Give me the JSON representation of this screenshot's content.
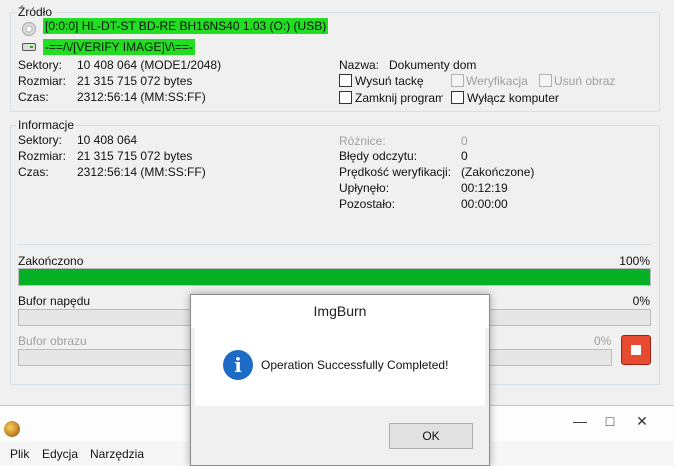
{
  "source": {
    "title": "Źródło",
    "drive": "[0:0:0] HL-DT-ST BD-RE  BH16NS40 1.03 (O:) (USB)",
    "image": "-==/\\/[VERIFY IMAGE]\\/\\==-",
    "sectors_label": "Sektory:",
    "sectors_value": "10 408 064 (MODE1/2048)",
    "size_label": "Rozmiar:",
    "size_value": "21 315 715 072 bytes",
    "time_label": "Czas:",
    "time_value": "2312:56:14 (MM:SS:FF)",
    "name_label": "Nazwa:",
    "name_value": "Dokumenty dom",
    "eject_label": "Wysuń tackę",
    "verify_label": "Weryfikacja",
    "delete_image_label": "Usuń obraz",
    "close_program_label": "Zamknij program",
    "shutdown_label": "Wyłącz komputer"
  },
  "info": {
    "title": "Informacje",
    "sectors_label": "Sektory:",
    "sectors_value": "10 408 064",
    "size_label": "Rozmiar:",
    "size_value": "21 315 715 072 bytes",
    "time_label": "Czas:",
    "time_value": "2312:56:14 (MM:SS:FF)",
    "diff_label": "Różnice:",
    "diff_value": "0",
    "read_errors_label": "Błędy odczytu:",
    "read_errors_value": "0",
    "verify_speed_label": "Prędkość weryfikacji:",
    "verify_speed_value": "(Zakończone)",
    "elapsed_label": "Upłynęło:",
    "elapsed_value": "00:12:19",
    "remaining_label": "Pozostało:",
    "remaining_value": "00:00:00"
  },
  "progress": {
    "label": "Zakończono",
    "percent_text": "100%",
    "fraction": 1.0
  },
  "drive_buffer": {
    "label": "Bufor napędu",
    "percent_text": "0%",
    "fraction": 0
  },
  "image_buffer": {
    "label": "Bufor obrazu",
    "percent_text": "0%",
    "fraction": 0
  },
  "dialog": {
    "title": "ImgBurn",
    "message": "Operation Successfully Completed!",
    "ok_label": "OK",
    "icon": "info-icon"
  },
  "menu": {
    "file": "Plik",
    "edit": "Edycja",
    "tools": "Narzędzia"
  },
  "colors": {
    "highlight": "#22dd22",
    "progress_fill": "#06b025",
    "stop_button": "#e64a30",
    "info_icon": "#1b6bc7"
  }
}
